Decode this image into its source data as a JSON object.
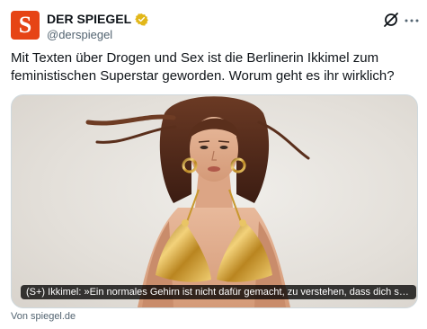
{
  "author": {
    "avatar_letter": "S",
    "display_name": "DER SPIEGEL",
    "handle": "@derspiegel",
    "verified_color": "#e2b719",
    "avatar_color": "#e64415"
  },
  "actions": {
    "grok_icon": "grok-icon",
    "more_icon": "more-icon"
  },
  "tweet": {
    "text": "Mit Texten über Drogen und Sex ist die Berlinerin Ikkimel zum feministischen Superstar geworden. Worum geht es ihr wirklich?"
  },
  "card": {
    "caption": "(S+) Ikkimel: »Ein normales Gehirn ist nicht dafür gemacht, zu verstehen, dass dich so ...",
    "source": "Von spiegel.de"
  }
}
